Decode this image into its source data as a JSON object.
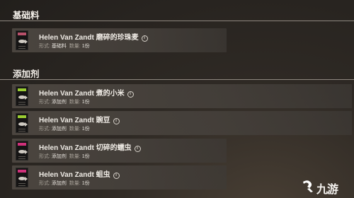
{
  "sections": [
    {
      "title": "基础料"
    },
    {
      "title": "添加剂"
    }
  ],
  "base_items": [
    {
      "name": "Helen Van Zandt 磨碎的珍珠麦",
      "form_label": "形式:",
      "form_value": "基础料",
      "qty_label": "数量:",
      "qty_value": "1份",
      "icon": "fish-bait-icon",
      "band_color": "#b8506a"
    }
  ],
  "additive_items": [
    {
      "name": "Helen Van Zandt 煮的小米",
      "form_label": "形式:",
      "form_value": "添加剂",
      "qty_label": "数量:",
      "qty_value": "1份",
      "icon": "fish-bait-icon",
      "band_color": "#9acd32"
    },
    {
      "name": "Helen Van Zandt 豌豆",
      "form_label": "形式:",
      "form_value": "添加剂",
      "qty_label": "数量:",
      "qty_value": "1份",
      "icon": "fish-bait-icon",
      "band_color": "#9acd32"
    },
    {
      "name": "Helen Van Zandt 切碎的蠕虫",
      "form_label": "形式:",
      "form_value": "添加剂",
      "qty_label": "数量:",
      "qty_value": "1份",
      "icon": "fish-bait-icon",
      "band_color": "#d0307a"
    },
    {
      "name": "Helen Van Zandt 蛆虫",
      "form_label": "形式:",
      "form_value": "添加剂",
      "qty_label": "数量:",
      "qty_value": "1份",
      "icon": "fish-bait-icon",
      "band_color": "#d0307a"
    }
  ],
  "watermark": {
    "text": "九游",
    "icon": "jiuyou-logo-icon",
    "color": "#ffffff"
  }
}
